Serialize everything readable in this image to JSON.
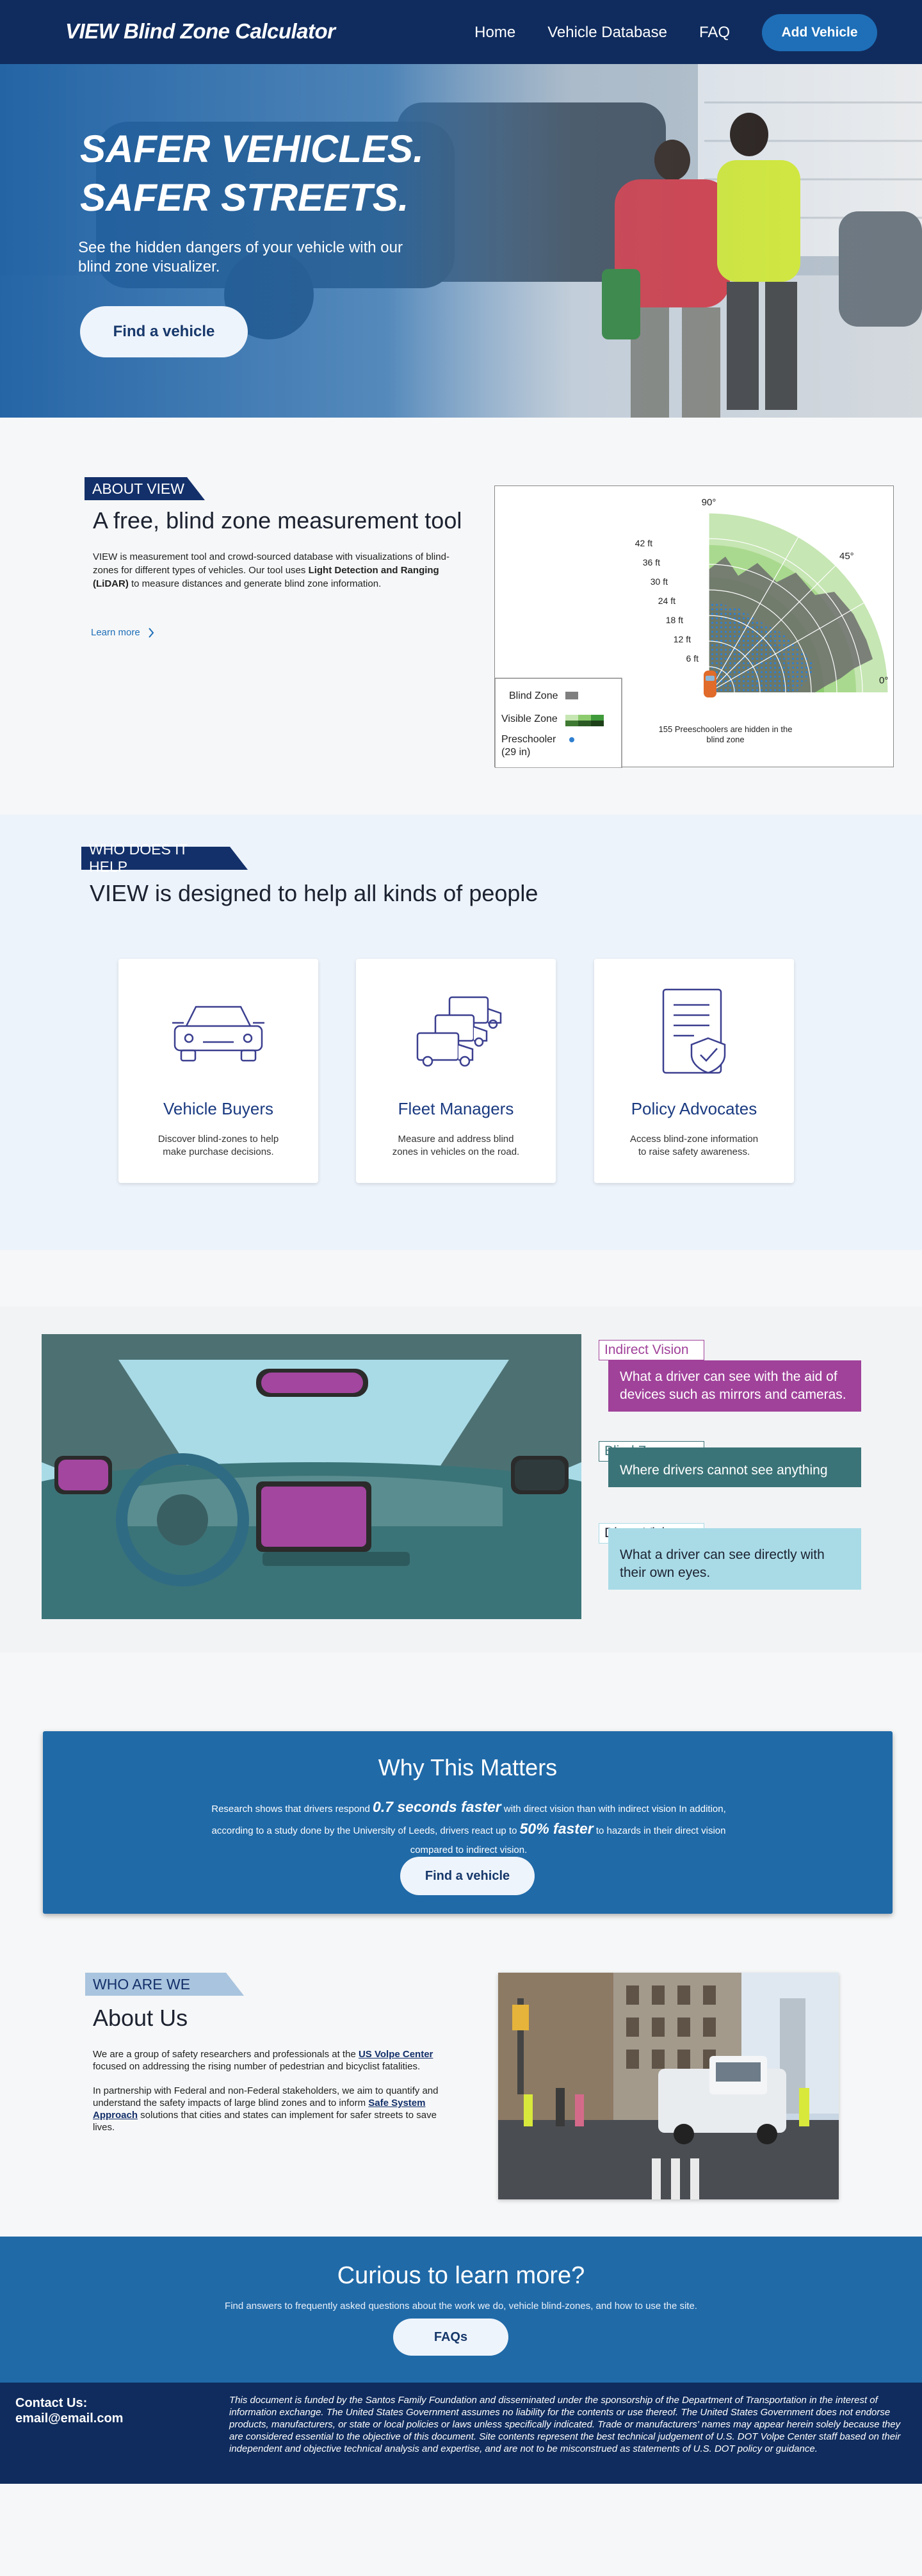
{
  "nav": {
    "brand": "VIEW Blind Zone Calculator",
    "links": [
      "Home",
      "Vehicle Database",
      "FAQ"
    ],
    "cta": "Add Vehicle"
  },
  "hero": {
    "title_line1": "SAFER VEHICLES.",
    "title_line2": "SAFER STREETS.",
    "subtitle": "See the hidden dangers of your vehicle  with our blind zone visualizer.",
    "button": "Find a vehicle"
  },
  "about": {
    "tag": "ABOUT VIEW",
    "heading": "A free, blind zone measurement tool",
    "text_pre": "VIEW is measurement tool and crowd-sourced database with visualizations of blind-zones for different types of vehicles. Our tool uses ",
    "text_bold": "Light Detection and Ranging (LiDAR)",
    "text_post": " to measure distances and generate blind zone information.",
    "learn_more": "Learn more",
    "chart": {
      "angle_labels": [
        "90°",
        "45°",
        "0°"
      ],
      "distance_labels": [
        "42 ft",
        "36 ft",
        "30 ft",
        "24 ft",
        "18 ft",
        "12 ft",
        "6 ft"
      ],
      "legend": {
        "blind_zone": "Blind Zone",
        "visible_zone": "Visible Zone",
        "preschooler": "Preschooler (29 in)"
      },
      "caption": "155 Preeschoolers are hidden in the blind zone",
      "colors": {
        "blind": "#7f7f7f",
        "visible_light": "#c6e6b3",
        "visible_mid": "#8ccc6e",
        "visible_dark": "#3f9a3a",
        "preschooler": "#2f7fd0",
        "car": "#e06b2a"
      }
    }
  },
  "help": {
    "tag": "WHO DOES IT HELP",
    "heading": "VIEW is designed to help all kinds of people",
    "cards": [
      {
        "title": "Vehicle Buyers",
        "desc": "Discover blind-zones to help make purchase decisions."
      },
      {
        "title": "Fleet Managers",
        "desc": "Measure and address blind zones in vehicles on the road."
      },
      {
        "title": "Policy Advocates",
        "desc": "Access blind-zone information to raise safety awareness."
      }
    ]
  },
  "vision": {
    "indirect": {
      "label": "Indirect Vision",
      "text": "What a driver can see with the aid of devices such as mirrors and cameras.",
      "color": "#a0429a"
    },
    "blind": {
      "label": "Blind Zone",
      "text": "Where drivers cannot see anything",
      "color": "#3b7478"
    },
    "direct": {
      "label": "Direct Vision",
      "text": "What a driver can see directly with their own eyes.",
      "color": "#a9dbe7"
    }
  },
  "why": {
    "title": "Why This Matters",
    "text1": "Research shows that drivers respond ",
    "em1": "0.7 seconds faster",
    "text2": " with direct vision than with indirect vision In addition, according to a study done by the University of Leeds, drivers react up to ",
    "em2": "50% faster",
    "text3": " to hazards in their direct vision compared to indirect vision.",
    "button": "Find a vehicle"
  },
  "we": {
    "tag": "WHO ARE WE",
    "heading": "About Us",
    "p1_pre": "We are a group of safety researchers and professionals at the ",
    "p1_link": "US Volpe Center",
    "p1_post": " focused on addressing the rising number of pedestrian and bicyclist fatalities.",
    "p2_pre": "In partnership with Federal and non-Federal stakeholders, we aim to quantify and understand the safety impacts of large blind zones and to inform ",
    "p2_link": "Safe System Approach",
    "p2_post": " solutions that cities and states can implement for safer streets to save lives."
  },
  "curious": {
    "title": "Curious to learn more?",
    "subtitle": "Find answers to frequently asked questions about the work we do, vehicle blind-zones, and how to use the site.",
    "button": "FAQs"
  },
  "footer": {
    "contact_label": "Contact Us:",
    "email": "email@email.com",
    "disclaimer": "This document is funded by the Santos Family Foundation and disseminated under the sponsorship of the Department of Transportation in the interest of information exchange. The United States Government assumes no liability for the contents or use thereof. The United States Government does not endorse products, manufacturers, or state or local policies or laws unless specifically indicated. Trade or manufacturers' names may appear herein solely because they are considered essential to the objective of this document. Site contents represent the best technical judgement of U.S. DOT Volpe Center staff based on their independent and objective technical analysis and expertise, and are not to be misconstrued as statements of U.S. DOT policy or guidance."
  }
}
